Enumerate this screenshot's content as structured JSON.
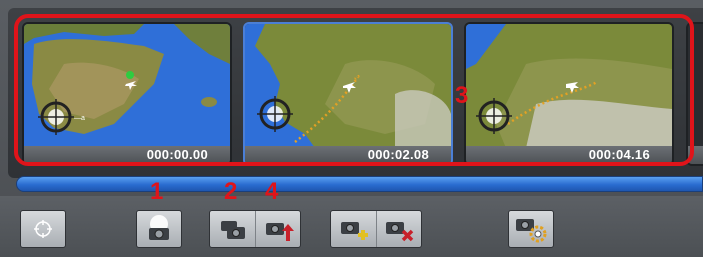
{
  "timeline": {
    "keyframes": [
      {
        "time": "000:00.00",
        "selected": false
      },
      {
        "time": "000:02.08",
        "selected": true
      },
      {
        "time": "000:04.16",
        "selected": false
      }
    ]
  },
  "callouts": [
    "1",
    "2",
    "4",
    "3"
  ],
  "progress": {
    "fill_percent": 100
  },
  "toolbar": {
    "buttons": [
      "crosshair-icon",
      "camera-flash-icon",
      "multi-camera-icon",
      "camera-export-icon",
      "camera-add-icon",
      "camera-delete-icon",
      "camera-settings-icon"
    ]
  },
  "colors": {
    "highlight": "#e0141a",
    "progress": "#2a6cd0",
    "selection": "#4b7fd6",
    "sea": "#2f6fd8",
    "land": "#7a8a3a"
  }
}
